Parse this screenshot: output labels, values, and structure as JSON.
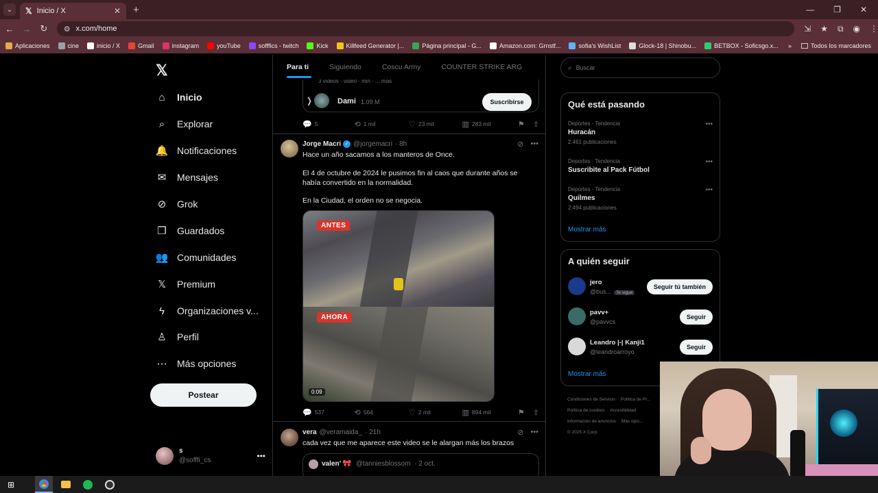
{
  "browser": {
    "tab_title": "Inicio / X",
    "url": "x.com/home",
    "bookmarks": [
      {
        "label": "Aplicaciones",
        "color": "#e8a94a"
      },
      {
        "label": "cine",
        "color": "#9aa0a6"
      },
      {
        "label": "inicio / X",
        "color": "#ffffff"
      },
      {
        "label": "Gmail",
        "color": "#ea4335"
      },
      {
        "label": "instagram",
        "color": "#e1306c"
      },
      {
        "label": "youTube",
        "color": "#ff0000"
      },
      {
        "label": "sofffics - twitch",
        "color": "#9146ff"
      },
      {
        "label": "Kick",
        "color": "#53fc18"
      },
      {
        "label": "Killfeed Generator |...",
        "color": "#f0c419"
      },
      {
        "label": "Página principal - G...",
        "color": "#34a853"
      },
      {
        "label": "Amazon.com: Grnstf...",
        "color": "#ffffff"
      },
      {
        "label": "sofia's WishList",
        "color": "#5fb3f9"
      },
      {
        "label": "Glock-18 | Shinobu...",
        "color": "#dddddd"
      },
      {
        "label": "BETBOX - Soficsgo.x...",
        "color": "#2ecc71"
      }
    ],
    "bookmarks_all": "Todos los marcadores"
  },
  "nav": {
    "items": [
      {
        "label": "Inicio",
        "icon": "⌂",
        "active": true
      },
      {
        "label": "Explorar",
        "icon": "⌕"
      },
      {
        "label": "Notificaciones",
        "icon": "🔔"
      },
      {
        "label": "Mensajes",
        "icon": "✉"
      },
      {
        "label": "Grok",
        "icon": "⊘"
      },
      {
        "label": "Guardados",
        "icon": "❐"
      },
      {
        "label": "Comunidades",
        "icon": "👥"
      },
      {
        "label": "Premium",
        "icon": "𝕏"
      },
      {
        "label": "Organizaciones v...",
        "icon": "ϟ"
      },
      {
        "label": "Perfil",
        "icon": "♙"
      },
      {
        "label": "Más opciones",
        "icon": "⋯"
      }
    ],
    "post_button": "Postear",
    "account": {
      "name": "s",
      "handle": "@sofffi_cs"
    }
  },
  "feed": {
    "tabs": [
      "Para ti",
      "Siguiendo",
      "Coscu Army",
      "COUNTER STRIKE ARG"
    ],
    "embed": {
      "top_text": "3 videos · video · min · ... más",
      "name": "Dami",
      "count": "1.09 M",
      "subscribe": "Suscribirse"
    },
    "actions1": {
      "replies": "5",
      "reposts": "1 mil",
      "likes": "23 mil",
      "views": "283 mil"
    },
    "tweet": {
      "name": "Jorge Macri",
      "handle": "@jorgemacri",
      "time": "· 8h",
      "line1": "Hace un año sacamos a los manteros de Once.",
      "line2": "El 4 de octubre de 2024 le pusimos fin al caos que durante años se había convertido en la normalidad.",
      "line3": "En la Ciudad, el orden no se negocia.",
      "label_before": "ANTES",
      "label_after": "AHORA",
      "duration": "0:09"
    },
    "actions2": {
      "replies": "537",
      "reposts": "564",
      "likes": "2 mil",
      "views": "894 mil"
    },
    "tweet2": {
      "name": "vera",
      "handle": "@veramaida_",
      "time": "· 21h",
      "text": "cada vez que me aparece este video se le alargan más los brazos",
      "quote_name": "valen’ 🎀",
      "quote_handle": "@tanniesblossom",
      "quote_time": "· 2 oct."
    }
  },
  "right": {
    "search_placeholder": "Buscar",
    "trends_title": "Qué está pasando",
    "trends": [
      {
        "category": "Deportes · Tendencia",
        "name": "Huracán",
        "count": "2.461 publicaciones"
      },
      {
        "category": "Deportes · Tendencia",
        "name": "Suscribite al Pack Fútbol",
        "count": ""
      },
      {
        "category": "Deportes · Tendencia",
        "name": "Quilmes",
        "count": "2.494 publicaciones"
      }
    ],
    "show_more": "Mostrar más",
    "follow_title": "A quién seguir",
    "follows": [
      {
        "name": "jero",
        "handle": "@bus...",
        "badge": "Te sigue",
        "button": "Seguir tú también",
        "color": "#1a3a8a"
      },
      {
        "name": "pavv+",
        "handle": "@pavvcs",
        "badge": "",
        "button": "Seguir",
        "color": "#3c6b66"
      },
      {
        "name": "Leandro |-| Kanji1",
        "handle": "@leandroarroyo",
        "badge": "",
        "button": "Seguir",
        "color": "#d9d9d9"
      }
    ],
    "footer": [
      "Condiciones de Servicio",
      "Política de Pr...",
      "Política de cookies",
      "Accesibilidad",
      "Información de anuncios",
      "Más opci...",
      "© 2025 X Corp."
    ]
  }
}
